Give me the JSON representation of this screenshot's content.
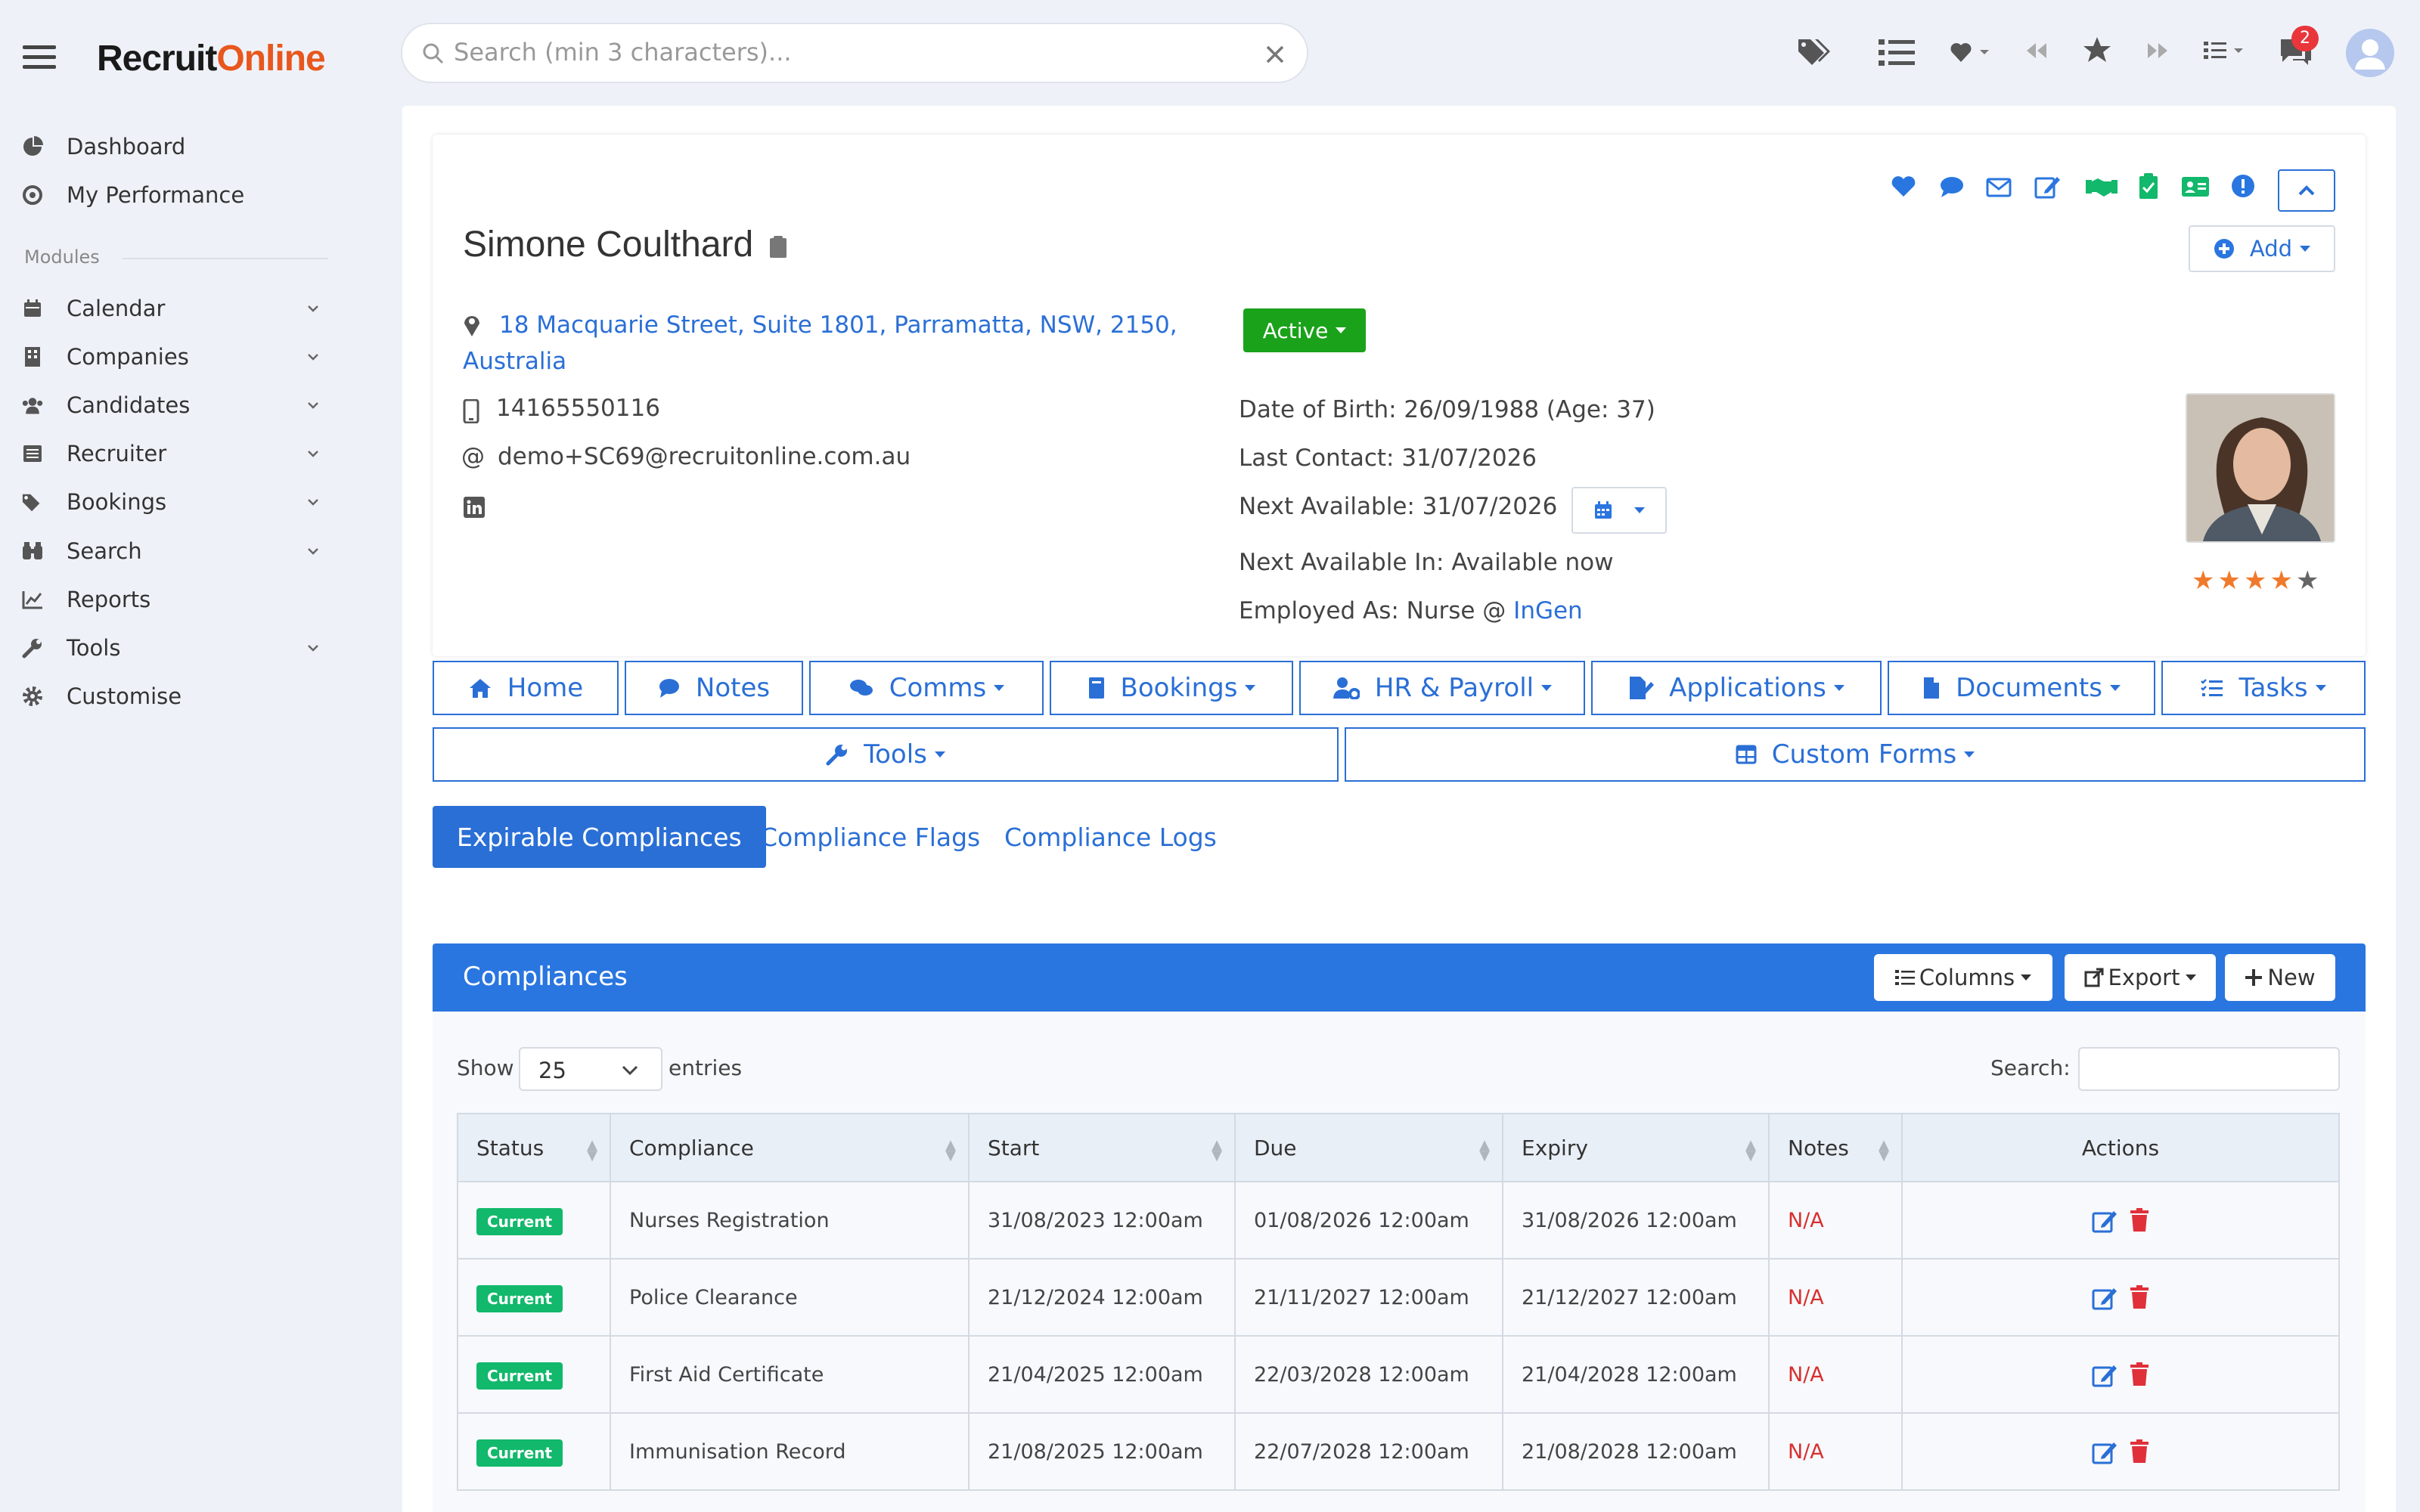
{
  "app": {
    "logo_pre": "Recruit",
    "logo_o": "O",
    "logo_post": "nline"
  },
  "sidebar": {
    "top": [
      {
        "label": "Dashboard",
        "icon": "chart-pie-icon"
      },
      {
        "label": "My Performance",
        "icon": "target-icon"
      }
    ],
    "modules_heading": "Modules",
    "items": [
      {
        "label": "Calendar",
        "icon": "calendar-icon",
        "expand": true
      },
      {
        "label": "Companies",
        "icon": "building-icon",
        "expand": true
      },
      {
        "label": "Candidates",
        "icon": "users-icon",
        "expand": true
      },
      {
        "label": "Recruiter",
        "icon": "list-icon",
        "expand": true
      },
      {
        "label": "Bookings",
        "icon": "tags-icon",
        "expand": true
      },
      {
        "label": "Search",
        "icon": "binoculars-icon",
        "expand": true
      },
      {
        "label": "Reports",
        "icon": "chart-line-icon",
        "expand": false
      },
      {
        "label": "Tools",
        "icon": "wrench-icon",
        "expand": true
      },
      {
        "label": "Customise",
        "icon": "gear-icon",
        "expand": false
      }
    ]
  },
  "search": {
    "placeholder": "Search (min 3 characters)..."
  },
  "topbar": {
    "notification_count": "2"
  },
  "candidate": {
    "name": "Simone Coulthard",
    "address": "18 Macquarie Street, Suite 1801, Parramatta, NSW, 2150, Australia",
    "phone": "14165550116",
    "email": "demo+SC69@recruitonline.com.au",
    "status": "Active",
    "dob": "Date of Birth: 26/09/1988 (Age: 37)",
    "last_contact": "Last Contact: 31/07/2026",
    "next_available": "Next Available: 31/07/2026",
    "next_available_in": "Next Available In: Available now",
    "employed_prefix": "Employed As: Nurse @ ",
    "employer": "InGen",
    "rating": 4,
    "add_label": "Add"
  },
  "tabs": [
    {
      "label": "Home",
      "icon": "home-icon",
      "dd": false
    },
    {
      "label": "Notes",
      "icon": "comment-icon",
      "dd": false
    },
    {
      "label": "Comms",
      "icon": "comments-icon",
      "dd": true
    },
    {
      "label": "Bookings",
      "icon": "book-icon",
      "dd": true
    },
    {
      "label": "HR & Payroll",
      "icon": "user-gear-icon",
      "dd": true
    },
    {
      "label": "Applications",
      "icon": "file-edit-icon",
      "dd": true
    },
    {
      "label": "Documents",
      "icon": "file-icon",
      "dd": true
    },
    {
      "label": "Tasks",
      "icon": "tasks-icon",
      "dd": true
    }
  ],
  "tabs2": [
    {
      "label": "Tools",
      "icon": "wrench-icon"
    },
    {
      "label": "Custom Forms",
      "icon": "table-icon"
    }
  ],
  "subtabs": [
    "Expirable Compliances",
    "Compliance Flags",
    "Compliance Logs"
  ],
  "compliances": {
    "title": "Compliances",
    "columns_btn": "Columns",
    "export_btn": "Export",
    "new_btn": "New",
    "show_label": "Show",
    "entries_value": "25",
    "entries_label": "entries",
    "search_label": "Search:",
    "headers": [
      "Status",
      "Compliance",
      "Start",
      "Due",
      "Expiry",
      "Notes",
      "Actions"
    ],
    "rows": [
      {
        "status": "Current",
        "compliance": "Nurses Registration",
        "start": "31/08/2023 12:00am",
        "due": "01/08/2026 12:00am",
        "expiry": "31/08/2026 12:00am",
        "notes": "N/A"
      },
      {
        "status": "Current",
        "compliance": "Police Clearance",
        "start": "21/12/2024 12:00am",
        "due": "21/11/2027 12:00am",
        "expiry": "21/12/2027 12:00am",
        "notes": "N/A"
      },
      {
        "status": "Current",
        "compliance": "First Aid Certificate",
        "start": "21/04/2025 12:00am",
        "due": "22/03/2028 12:00am",
        "expiry": "21/04/2028 12:00am",
        "notes": "N/A"
      },
      {
        "status": "Current",
        "compliance": "Immunisation Record",
        "start": "21/08/2025 12:00am",
        "due": "22/07/2028 12:00am",
        "expiry": "21/08/2028 12:00am",
        "notes": "N/A"
      }
    ]
  }
}
